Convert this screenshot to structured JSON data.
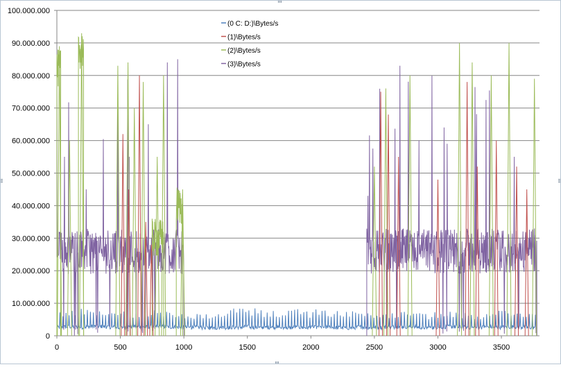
{
  "chart_data": {
    "type": "line",
    "title": "",
    "xlabel": "",
    "ylabel": "",
    "xlim": [
      0,
      3800
    ],
    "ylim": [
      0,
      100000000
    ],
    "x_ticks": [
      0,
      500,
      1000,
      1500,
      2000,
      2500,
      3000,
      3500
    ],
    "x_tick_labels": [
      "0",
      "500",
      "1000",
      "1500",
      "2000",
      "2500",
      "3000",
      "3500"
    ],
    "y_ticks": [
      0,
      10000000,
      20000000,
      30000000,
      40000000,
      50000000,
      60000000,
      70000000,
      80000000,
      90000000,
      100000000
    ],
    "y_tick_labels": [
      "0",
      "10.000.000",
      "20.000.000",
      "30.000.000",
      "40.000.000",
      "50.000.000",
      "60.000.000",
      "70.000.000",
      "80.000.000",
      "90.000.000",
      "100.000.000"
    ],
    "grid": "horizontal",
    "legend_position": "top-center",
    "series": [
      {
        "name": "(0 C: D:)\\Bytes/s",
        "color": "#4f81bd",
        "x": [
          0,
          100,
          200,
          300,
          400,
          500,
          600,
          700,
          800,
          900,
          1000,
          1100,
          1200,
          1300,
          1400,
          1500,
          1600,
          1700,
          1800,
          1900,
          2000,
          2100,
          2200,
          2300,
          2400,
          2500,
          2600,
          2700,
          2800,
          2900,
          3000,
          3100,
          3200,
          3300,
          3400,
          3500,
          3600,
          3700,
          3780
        ],
        "y": [
          2500000,
          2800000,
          2600000,
          3000000,
          2700000,
          2500000,
          2900000,
          2600000,
          2800000,
          2700000,
          2500000,
          2600000,
          2400000,
          2500000,
          2600000,
          2700000,
          2500000,
          2600000,
          2400000,
          2600000,
          2500000,
          2600000,
          2500000,
          2400000,
          2700000,
          2500000,
          2600000,
          2800000,
          2700000,
          2500000,
          2600000,
          2800000,
          2600000,
          2500000,
          2700000,
          2600000,
          2800000,
          2500000,
          2600000
        ],
        "y_peak": [
          8000000,
          7500000,
          8500000,
          8000000,
          7500000,
          8000000,
          7000000,
          7500000,
          8000000,
          7500000,
          7000000,
          7000000,
          7500000,
          8000000,
          8500000,
          9000000,
          8500000,
          8000000,
          8000000,
          8500000,
          8000000,
          8500000,
          8000000,
          7500000,
          8000000,
          7000000,
          7500000,
          8000000,
          7500000,
          7000000,
          7500000,
          8000000,
          7500000,
          7000000,
          7500000,
          8000000,
          7500000,
          7000000,
          7500000
        ]
      },
      {
        "name": "(1)\\Bytes/s",
        "color": "#c0504d",
        "spikes": [
          {
            "x": 520,
            "y": 62000000
          },
          {
            "x": 565,
            "y": 45000000
          },
          {
            "x": 650,
            "y": 80000000
          },
          {
            "x": 700,
            "y": 35000000
          },
          {
            "x": 745,
            "y": 28000000
          },
          {
            "x": 2550,
            "y": 75000000
          },
          {
            "x": 2610,
            "y": 68000000
          },
          {
            "x": 2690,
            "y": 55000000
          },
          {
            "x": 3000,
            "y": 48000000
          },
          {
            "x": 3230,
            "y": 78000000
          },
          {
            "x": 3310,
            "y": 52000000
          },
          {
            "x": 3460,
            "y": 60000000
          },
          {
            "x": 3620,
            "y": 52000000
          },
          {
            "x": 3700,
            "y": 45000000
          }
        ]
      },
      {
        "name": "(2)\\Bytes/s",
        "color": "#9bbb59",
        "segments": [
          {
            "x_start": 0,
            "x_end": 30,
            "level": 82000000
          },
          {
            "x_start": 170,
            "x_end": 210,
            "level": 88000000
          },
          {
            "x_start": 750,
            "x_end": 840,
            "level": 30000000
          },
          {
            "x_start": 940,
            "x_end": 990,
            "level": 40000000
          }
        ],
        "spikes": [
          {
            "x": 20,
            "y": 89000000
          },
          {
            "x": 100,
            "y": 60000000
          },
          {
            "x": 195,
            "y": 93000000
          },
          {
            "x": 480,
            "y": 83000000
          },
          {
            "x": 560,
            "y": 84000000
          },
          {
            "x": 610,
            "y": 70000000
          },
          {
            "x": 680,
            "y": 78000000
          },
          {
            "x": 790,
            "y": 55000000
          },
          {
            "x": 840,
            "y": 80000000
          },
          {
            "x": 990,
            "y": 45000000
          },
          {
            "x": 2500,
            "y": 52000000
          },
          {
            "x": 2590,
            "y": 76000000
          },
          {
            "x": 2780,
            "y": 80000000
          },
          {
            "x": 3170,
            "y": 90000000
          },
          {
            "x": 3270,
            "y": 84000000
          },
          {
            "x": 3420,
            "y": 80000000
          },
          {
            "x": 3560,
            "y": 90000000
          },
          {
            "x": 3760,
            "y": 79000000
          }
        ]
      },
      {
        "name": "(3)\\Bytes/s",
        "color": "#8064a2",
        "active_ranges": [
          {
            "x_start": 0,
            "x_end": 1000,
            "level": 26000000
          },
          {
            "x_start": 2440,
            "x_end": 3780,
            "level": 26000000
          }
        ],
        "spikes": [
          {
            "x": 0,
            "y": 85000000
          },
          {
            "x": 60,
            "y": 55000000
          },
          {
            "x": 230,
            "y": 45000000
          },
          {
            "x": 480,
            "y": 70000000
          },
          {
            "x": 570,
            "y": 55000000
          },
          {
            "x": 720,
            "y": 65000000
          },
          {
            "x": 870,
            "y": 84000000
          },
          {
            "x": 950,
            "y": 85000000
          },
          {
            "x": 2450,
            "y": 43000000
          },
          {
            "x": 2700,
            "y": 83000000
          },
          {
            "x": 2850,
            "y": 60000000
          },
          {
            "x": 3050,
            "y": 64000000
          },
          {
            "x": 3300,
            "y": 55000000
          },
          {
            "x": 3600,
            "y": 55000000
          },
          {
            "x": 3780,
            "y": 43000000
          }
        ]
      }
    ]
  }
}
